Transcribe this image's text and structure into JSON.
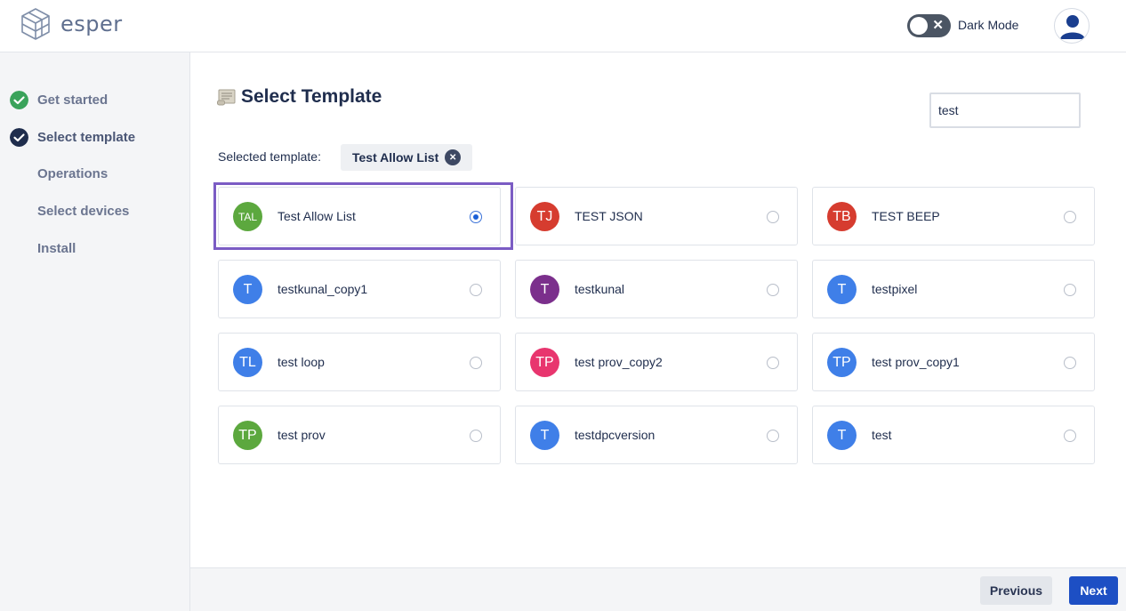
{
  "header": {
    "logo_text": "esper",
    "dark_mode_label": "Dark Mode",
    "dark_mode_on": false
  },
  "sidebar": {
    "steps": [
      {
        "label": "Get started",
        "status": "done",
        "icon": "check-circle-icon"
      },
      {
        "label": "Select template",
        "status": "current",
        "icon": "check-circle-icon"
      },
      {
        "label": "Operations",
        "status": "pending"
      },
      {
        "label": "Select devices",
        "status": "pending"
      },
      {
        "label": "Install",
        "status": "pending"
      }
    ]
  },
  "main": {
    "title": "Select Template",
    "title_icon": "scroll-icon",
    "search_value": "test",
    "selected_label": "Selected template:",
    "selected_template": "Test Allow List",
    "templates": [
      {
        "initials": "TAL",
        "name": "Test Allow List",
        "color": "#5ca83e",
        "selected": true
      },
      {
        "initials": "TJ",
        "name": "TEST JSON",
        "color": "#d63c2f",
        "selected": false
      },
      {
        "initials": "TB",
        "name": "TEST BEEP",
        "color": "#d63c2f",
        "selected": false
      },
      {
        "initials": "T",
        "name": "testkunal_copy1",
        "color": "#3f7fe8",
        "selected": false
      },
      {
        "initials": "T",
        "name": "testkunal",
        "color": "#7b2f8c",
        "selected": false
      },
      {
        "initials": "T",
        "name": "testpixel",
        "color": "#3f7fe8",
        "selected": false
      },
      {
        "initials": "TL",
        "name": "test loop",
        "color": "#3f7fe8",
        "selected": false
      },
      {
        "initials": "TP",
        "name": "test prov_copy2",
        "color": "#e8356e",
        "selected": false
      },
      {
        "initials": "TP",
        "name": "test prov_copy1",
        "color": "#3f7fe8",
        "selected": false
      },
      {
        "initials": "TP",
        "name": "test prov",
        "color": "#5ca83e",
        "selected": false
      },
      {
        "initials": "T",
        "name": "testdpcversion",
        "color": "#3f7fe8",
        "selected": false
      },
      {
        "initials": "T",
        "name": "test",
        "color": "#3f7fe8",
        "selected": false
      }
    ]
  },
  "footer": {
    "previous_label": "Previous",
    "next_label": "Next"
  },
  "colors": {
    "accent": "#1d4fc4",
    "check_done": "#3aa35b",
    "check_current": "#1f2d4d",
    "highlight": "#7b5cc4"
  }
}
